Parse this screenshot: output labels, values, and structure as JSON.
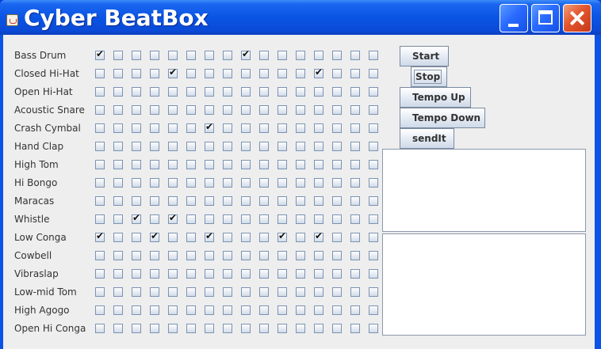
{
  "window": {
    "title": "Cyber BeatBox"
  },
  "instruments": [
    "Bass Drum",
    "Closed Hi-Hat",
    "Open Hi-Hat",
    "Acoustic Snare",
    "Crash Cymbal",
    "Hand Clap",
    "High Tom",
    "Hi Bongo",
    "Maracas",
    "Whistle",
    "Low Conga",
    "Cowbell",
    "Vibraslap",
    "Low-mid Tom",
    "High Agogo",
    "Open Hi Conga"
  ],
  "beats_per_row": 16,
  "checked": {
    "0": [
      0,
      8
    ],
    "1": [
      4,
      12
    ],
    "4": [
      6
    ],
    "9": [
      2,
      4
    ],
    "10": [
      0,
      3,
      6,
      10,
      12
    ]
  },
  "buttons": [
    {
      "label": "Start",
      "name": "start-button"
    },
    {
      "label": "Stop",
      "name": "stop-button"
    },
    {
      "label": "Tempo Up",
      "name": "tempo-up-button"
    },
    {
      "label": "Tempo Down",
      "name": "tempo-down-button"
    },
    {
      "label": "sendIt",
      "name": "send-it-button"
    }
  ],
  "incoming_list": {
    "value": ""
  },
  "message_box": {
    "value": ""
  }
}
